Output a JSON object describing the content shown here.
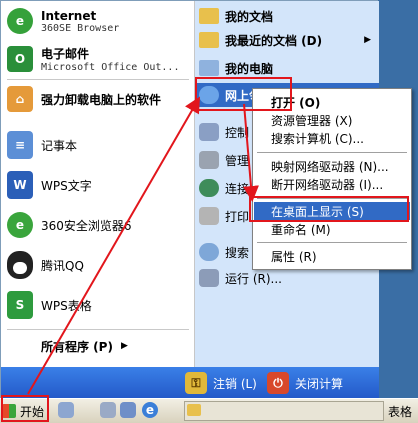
{
  "start_menu": {
    "pinned": [
      {
        "name": "Internet",
        "sub": "360SE Browser"
      },
      {
        "name": "电子邮件",
        "sub": "Microsoft Office Out..."
      }
    ],
    "recent": [
      "强力卸载电脑上的软件",
      "记事本",
      "WPS文字",
      "360安全浏览器6",
      "腾讯QQ",
      "WPS表格"
    ],
    "all_programs": "所有程序 (P)",
    "right_items": [
      "我的文档",
      "我最近的文档 (D)",
      "我的电脑",
      "网上邻居",
      "控制",
      "管理",
      "连接",
      "打印",
      "搜索",
      "运行 (R)..."
    ],
    "logoff": "注销 (L)",
    "shutdown": "关闭计算"
  },
  "context_menu": {
    "items": [
      "打开 (O)",
      "资源管理器 (X)",
      "搜索计算机 (C)...",
      "映射网络驱动器 (N)...",
      "断开网络驱动器 (I)...",
      "在桌面上显示 (S)",
      "重命名 (M)",
      "属性 (R)"
    ]
  },
  "taskbar": {
    "start_label": "开始",
    "right_label": "表格"
  },
  "colors": {
    "highlight": "#316ac5",
    "annotation": "#e2161c"
  }
}
